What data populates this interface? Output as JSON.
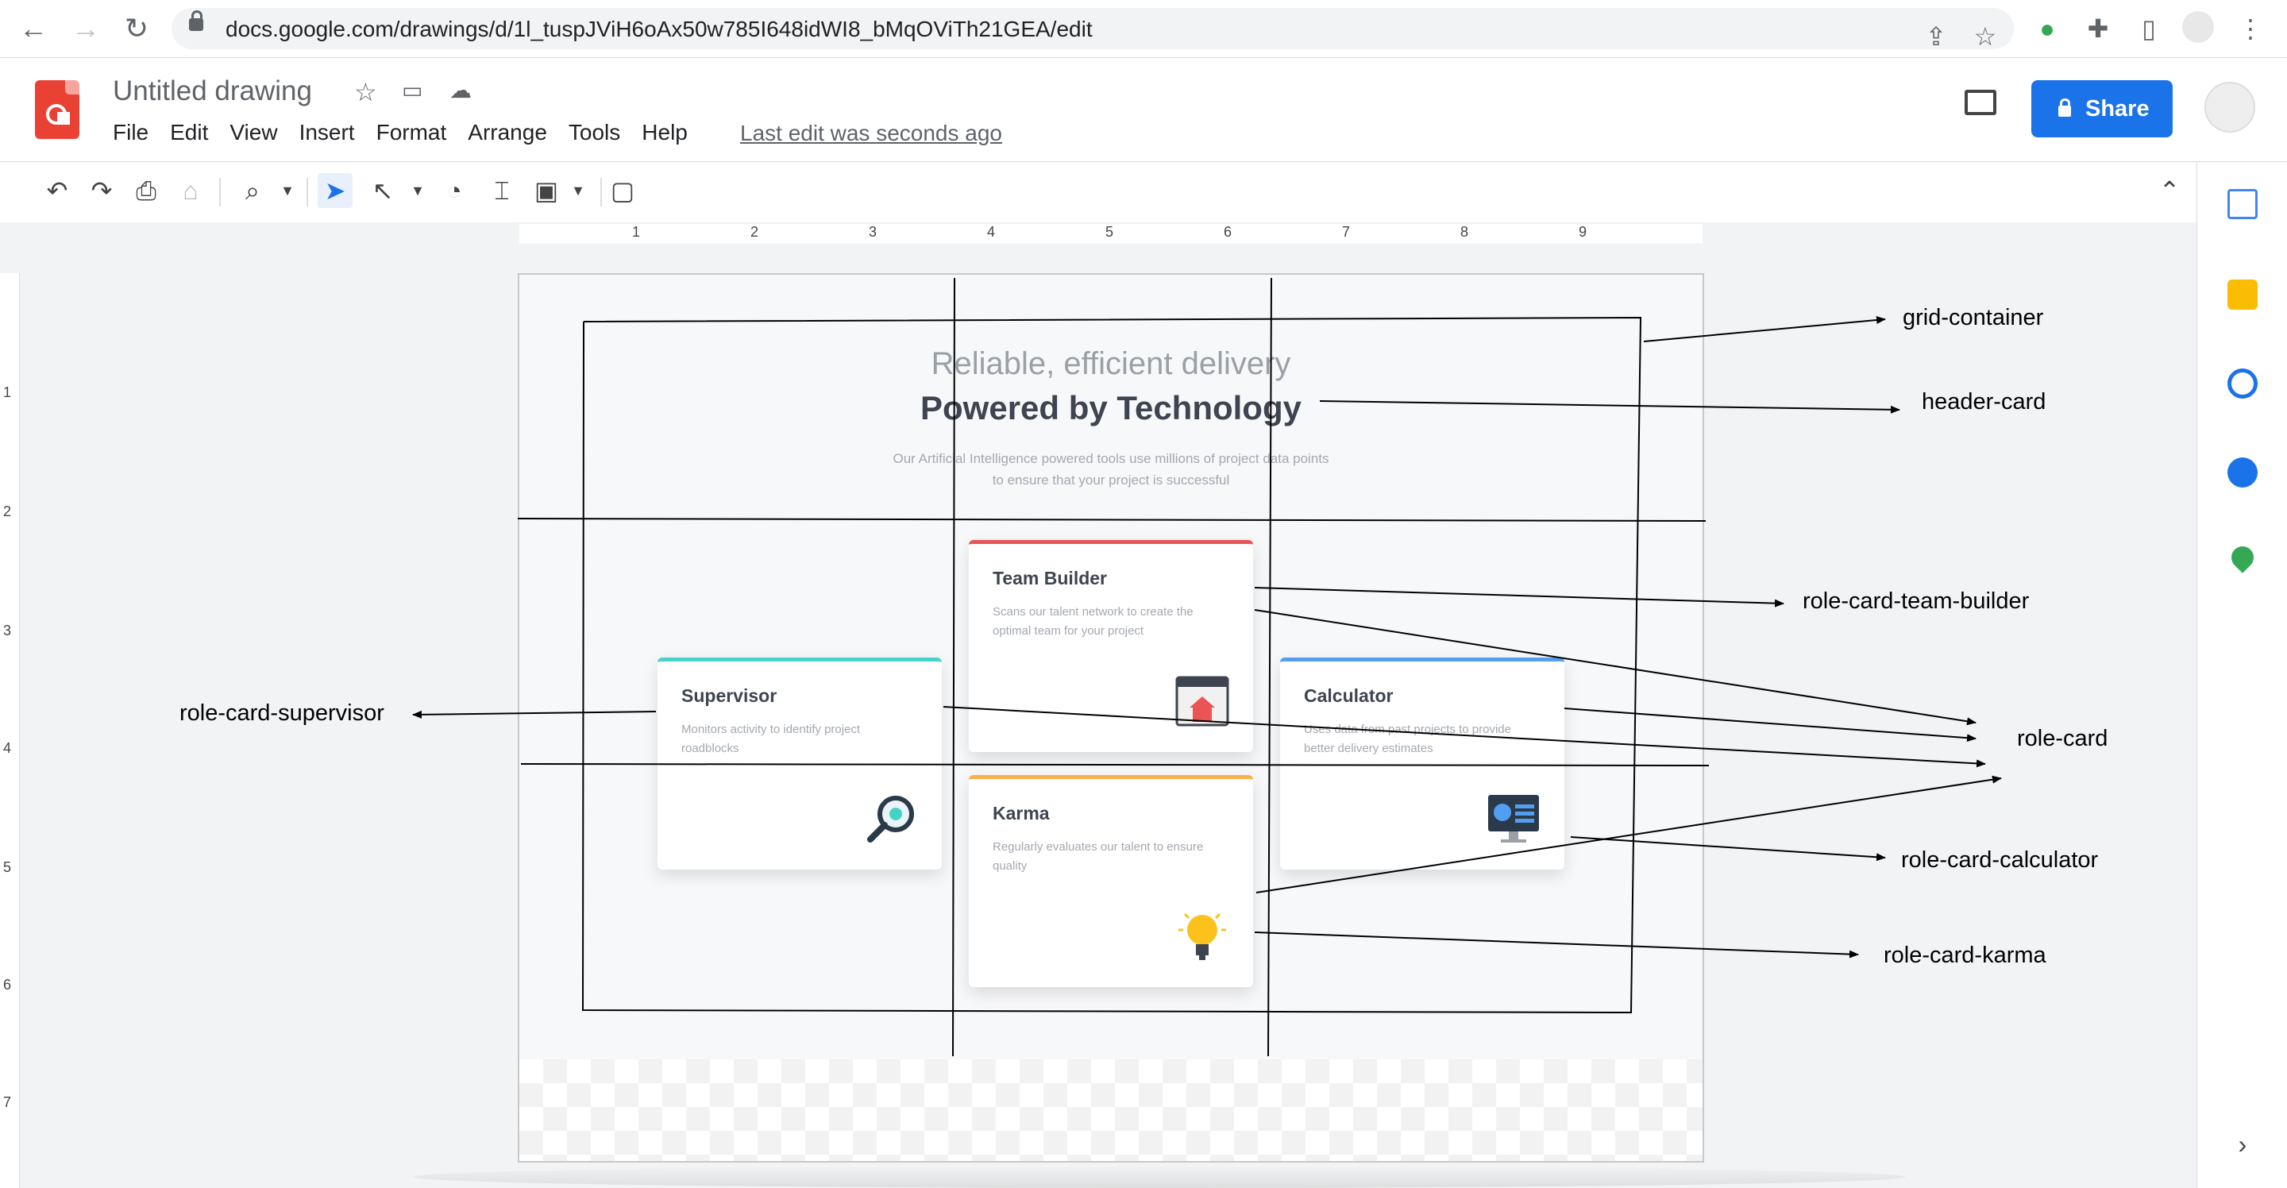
{
  "browser": {
    "url": "docs.google.com/drawings/d/1l_tuspJViH6oAx50w785I648idWI8_bMqOViTh21GEA/edit"
  },
  "doc": {
    "title": "Untitled drawing",
    "menus": [
      "File",
      "Edit",
      "View",
      "Insert",
      "Format",
      "Arrange",
      "Tools",
      "Help"
    ],
    "last_edit": "Last edit was seconds ago",
    "share_label": "Share"
  },
  "ruler": {
    "horizontal": [
      "1",
      "2",
      "3",
      "4",
      "5",
      "6",
      "7",
      "8",
      "9"
    ],
    "vertical": [
      "1",
      "2",
      "3",
      "4",
      "5",
      "6",
      "7"
    ]
  },
  "page": {
    "header": {
      "subtitle": "Reliable, efficient delivery",
      "title": "Powered by Technology",
      "description": "Our Artificial Intelligence powered tools use millions of project data points to ensure that your project is successful"
    },
    "cards": {
      "supervisor": {
        "title": "Supervisor",
        "desc": "Monitors activity to identify project roadblocks",
        "color": "#45d3c7",
        "icon": "magnifier-icon"
      },
      "team_builder": {
        "title": "Team Builder",
        "desc": "Scans our talent network to create the optimal team for your project",
        "color": "#ea5454",
        "icon": "browser-home-icon"
      },
      "calculator": {
        "title": "Calculator",
        "desc": "Uses data from past projects to provide better delivery estimates",
        "color": "#549ef2",
        "icon": "monitor-icon"
      },
      "karma": {
        "title": "Karma",
        "desc": "Regularly evaluates our talent to ensure quality",
        "color": "#fcae4a",
        "icon": "lightbulb-icon"
      }
    }
  },
  "annotations": {
    "grid_container": "grid-container",
    "header_card": "header-card",
    "role_card_team_builder": "role-card-team-builder",
    "role_card": "role-card",
    "role_card_calculator": "role-card-calculator",
    "role_card_karma": "role-card-karma",
    "role_card_supervisor": "role-card-supervisor"
  },
  "colors": {
    "share": "#1a73e8",
    "logo": "#e94235"
  }
}
